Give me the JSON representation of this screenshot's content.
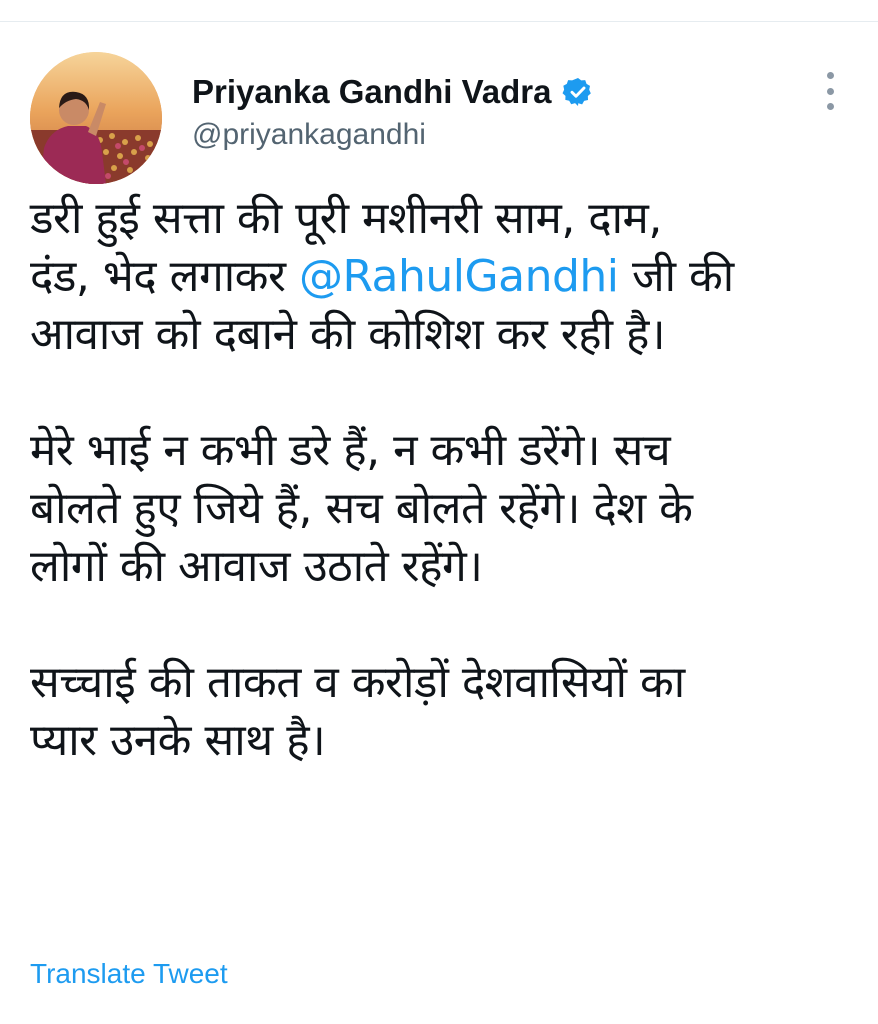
{
  "tweet": {
    "author": {
      "display_name": "Priyanka Gandhi Vadra",
      "handle": "@priyankagandhi",
      "verified": true,
      "avatar_icon": "profile-photo"
    },
    "paragraphs": [
      {
        "lines": [
          {
            "before": "डरी हुई सत्ता की पूरी मशीनरी साम, दाम,"
          },
          {
            "before": "दंड, भेद लगाकर ",
            "mention": "@RahulGandhi",
            "after": " जी की"
          },
          {
            "before": "आवाज को दबाने की कोशिश कर रही है।"
          }
        ]
      },
      {
        "lines": [
          {
            "before": "मेरे भाई न कभी डरे हैं, न कभी डरेंगे। सच"
          },
          {
            "before": "बोलते हुए जिये हैं, सच बोलते रहेंगे। देश के"
          },
          {
            "before": "लोगों की आवाज उठाते रहेंगे।"
          }
        ]
      },
      {
        "lines": [
          {
            "before": "सच्चाई की ताकत व करोड़ों देशवासियों का"
          },
          {
            "before": "प्यार उनके साथ है।"
          }
        ]
      }
    ],
    "translate_label": "Translate Tweet",
    "more_icon": "more-options-icon"
  },
  "colors": {
    "link": "#1d9bf0",
    "text": "#0f1419",
    "secondary": "#536471",
    "verified": "#1d9bf0"
  }
}
